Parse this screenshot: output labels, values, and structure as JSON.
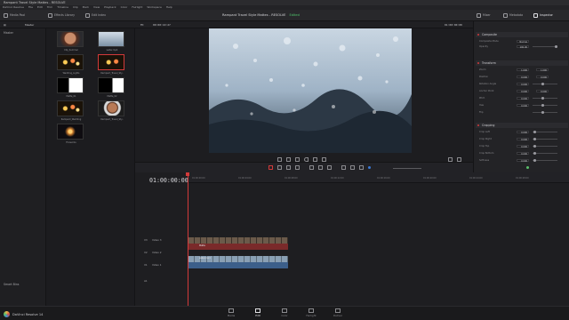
{
  "window": {
    "title": "Rampant Travel Style Mattes - RESOLVE"
  },
  "menu": [
    "DaVinci Resolve",
    "File",
    "Edit",
    "Trim",
    "Timeline",
    "Clip",
    "Mark",
    "View",
    "Playback",
    "Color",
    "Fairlight",
    "Workspace",
    "Help"
  ],
  "toolbar": {
    "media_pool": "Media Pool",
    "effects_library": "Effects Library",
    "edit_index": "Edit Index",
    "project_title": "Rampant Travel Style Mattes - RESOLVE",
    "project_status": "Edited",
    "mixer": "Mixer",
    "metadata": "Metadata",
    "inspector": "Inspector"
  },
  "subbar": {
    "bin": "Master",
    "timecode_left": "00:00:10:27",
    "fit": "Fit",
    "timecode_right": "01:00:00:00",
    "timeline_name": "Timeline 1"
  },
  "media_pool": {
    "master_label": "Master",
    "smart_bins_label": "Smart Bins",
    "clips": [
      {
        "name": "Clip_Summer",
        "kind": "face"
      },
      {
        "name": "water.mp4",
        "kind": "ice"
      },
      {
        "name": "Wedding_Lights",
        "kind": "lights"
      },
      {
        "name": "Rampant_Travel_Sty..",
        "kind": "lights_sel"
      },
      {
        "name": "Matte_01",
        "kind": "matte_a"
      },
      {
        "name": "Matte_02",
        "kind": "matte_b"
      },
      {
        "name": "Rampant_Wedding",
        "kind": "lights"
      },
      {
        "name": "Rampant_Travel_Sty..",
        "kind": "face2"
      },
      {
        "name": "Fireworks",
        "kind": "fireworks"
      }
    ]
  },
  "viewer": {
    "zoom": "Fit",
    "timecode": "01:00:00:00"
  },
  "inspector": {
    "sections": [
      {
        "label": "Composite"
      },
      {
        "label": "Transform"
      },
      {
        "label": "Cropping"
      }
    ],
    "composite": {
      "mode_label": "Composite Mode",
      "mode_value": "Normal",
      "opacity_label": "Opacity",
      "opacity_value": "100.00"
    },
    "transform": [
      {
        "label": "Zoom",
        "x": "1.000",
        "y": "1.000"
      },
      {
        "label": "Position",
        "x": "0.000",
        "y": "0.000"
      },
      {
        "label": "Rotation Angle",
        "x": "0.000",
        "y": ""
      },
      {
        "label": "Anchor Point",
        "x": "0.000",
        "y": "0.000"
      },
      {
        "label": "Pitch",
        "x": "0.000",
        "y": ""
      },
      {
        "label": "Yaw",
        "x": "0.000",
        "y": ""
      },
      {
        "label": "Flip",
        "x": "",
        "y": ""
      }
    ],
    "cropping": [
      {
        "label": "Crop Left",
        "value": "0.000"
      },
      {
        "label": "Crop Right",
        "value": "0.000"
      },
      {
        "label": "Crop Top",
        "value": "0.000"
      },
      {
        "label": "Crop Bottom",
        "value": "0.000"
      },
      {
        "label": "Softness",
        "value": "0.000"
      }
    ]
  },
  "timeline": {
    "timecode": "01:00:00:00",
    "ruler": [
      "01:00:00:00",
      "01:00:04:00",
      "01:00:08:00",
      "01:00:12:00",
      "01:00:16:00",
      "01:00:20:00",
      "01:00:24:00",
      "01:00:28:00"
    ],
    "tracks": [
      {
        "id": "V3",
        "name": "Video 3"
      },
      {
        "id": "V2",
        "name": "Video 2"
      },
      {
        "id": "V1",
        "name": "Video 1"
      },
      {
        "id": "A1",
        "name": ""
      }
    ],
    "clip_labels": {
      "v2": "Matte",
      "v1": "water.mp4"
    }
  },
  "pages": [
    "Media",
    "Edit",
    "Color",
    "Fairlight",
    "Deliver"
  ],
  "active_page": "Edit",
  "brand": "DaVinci Resolve 14",
  "colors": {
    "accent": "#d23a3a",
    "status_green": "#4fc36b"
  }
}
